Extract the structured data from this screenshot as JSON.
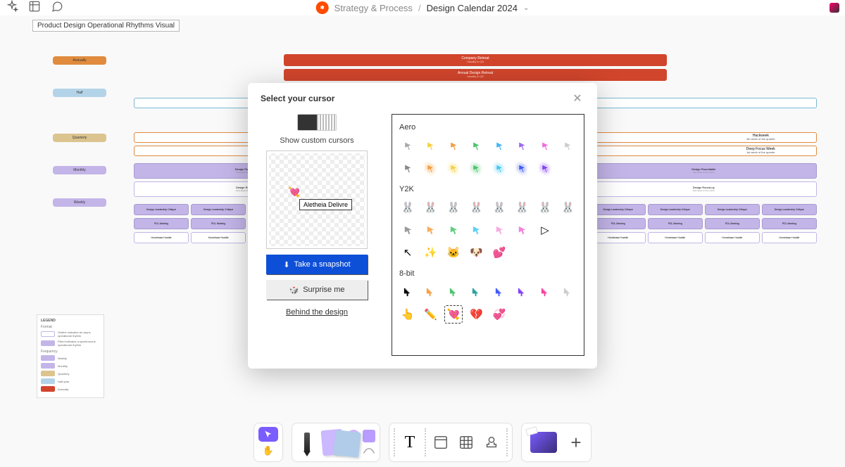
{
  "header": {
    "app": "zapier",
    "breadcrumb1": "Strategy & Process",
    "breadcrumb2": "Design Calendar 2024"
  },
  "doc_title": "Product Design Operational Rhythms Visual",
  "side_pills": [
    {
      "label": "Annually",
      "kind": "orange"
    },
    {
      "label": "Half",
      "kind": "blue"
    },
    {
      "label": "Quarterly",
      "kind": "tan",
      "gap": 60
    },
    {
      "label": "Monthly",
      "kind": "purple",
      "gap": 46
    },
    {
      "label": "Weekly",
      "kind": "purple",
      "gap": 46
    }
  ],
  "legend": {
    "title": "LEGEND",
    "format_label": "Format",
    "rows_format": [
      {
        "color": "#ffffff",
        "border": "#c3b5e8",
        "text": "Outline indicates an async operational rhythm"
      },
      {
        "color": "#c3b5e8",
        "text": "Filled indicates a synchronous operational rhythm"
      }
    ],
    "frequency_label": "Frequency",
    "rows_freq": [
      {
        "color": "#c3b5e8",
        "text": "Weekly"
      },
      {
        "color": "#c3b5e8",
        "text": "Monthly"
      },
      {
        "color": "#dcc48e",
        "text": "Quarterly"
      },
      {
        "color": "#b3d4e8",
        "text": "Half-year"
      },
      {
        "color": "#d1452c",
        "text": "Annually"
      }
    ]
  },
  "timeline": {
    "red_bars": [
      {
        "title": "Company Retreat",
        "sub": "Usually in Q3"
      },
      {
        "title": "Annual Design Retreat",
        "sub": "Usually in Q2"
      }
    ],
    "hackweek": {
      "title": "Hackweek",
      "sub": "4th week of the quarter"
    },
    "deep_focus": {
      "title": "Deep Focus Week",
      "sub": "1st week of the quarter"
    },
    "roundtables": [
      {
        "title": "Design Roundtable",
        "sub": "2nd week of the month"
      },
      {
        "title": "Design Roundtable",
        "sub": "2nd week of the month"
      },
      {
        "title": "Design Roundtable",
        "sub": "2nd week of the month"
      }
    ],
    "roundups": [
      {
        "title": "Design Round-up",
        "sub": "End week of the month"
      },
      {
        "title": "Design Round-up",
        "sub": "End week of the month"
      },
      {
        "title": "Design Round-up",
        "sub": "End week of the month"
      }
    ],
    "weekly_row1": {
      "title": "Design Leadership Critique",
      "sub": ""
    },
    "weekly_row2": {
      "title": "PDL Meeting"
    },
    "weekly_row3": {
      "title": "Homebase Huddle"
    }
  },
  "modal": {
    "title": "Select your cursor",
    "show_label": "Show custom cursors",
    "preview_name": "Aletheia Delivre",
    "snapshot_label": "Take a snapshot",
    "surprise_label": "Surprise me",
    "link_label": "Behind the design",
    "groups": [
      {
        "name": "Aero",
        "cursors": [
          {
            "c": "#aaa"
          },
          {
            "c": "#f5d142"
          },
          {
            "c": "#f59e42"
          },
          {
            "c": "#4cc46e"
          },
          {
            "c": "#42b6f5"
          },
          {
            "c": "#9b6bf2"
          },
          {
            "c": "#f26bdb"
          },
          {
            "c": "#ccc"
          },
          {
            "c": "#888"
          },
          {
            "c": "#f59e42",
            "glow": 1
          },
          {
            "c": "#f5d142",
            "glow": 1
          },
          {
            "c": "#4cc46e",
            "glow": 1
          },
          {
            "c": "#42c8f5",
            "glow": 1
          },
          {
            "c": "#425af5",
            "glow": 1
          },
          {
            "c": "#8542f5",
            "glow": 1
          }
        ]
      },
      {
        "name": "Y2K",
        "cursors": [
          {
            "emoji": "🐰"
          },
          {
            "emoji": "🐰"
          },
          {
            "emoji": "🐰"
          },
          {
            "emoji": "🐰"
          },
          {
            "emoji": "🐰"
          },
          {
            "emoji": "🐰"
          },
          {
            "emoji": "🐰"
          },
          {
            "emoji": "🐰"
          },
          {
            "c": "#888",
            "y2k": 1
          },
          {
            "c": "#f59e42",
            "y2k": 1
          },
          {
            "c": "#4cc46e",
            "y2k": 1
          },
          {
            "c": "#42c8f5",
            "y2k": 1
          },
          {
            "c": "#f59dde",
            "y2k": 1
          },
          {
            "c": "#f26bdb",
            "y2k": 1
          },
          {
            "emoji": "▷"
          },
          {
            "blank": 1
          },
          {
            "emoji": "↖",
            "bw": 1
          },
          {
            "emoji": "✨"
          },
          {
            "emoji": "🐱"
          },
          {
            "emoji": "🐶"
          },
          {
            "emoji": "💕"
          }
        ]
      },
      {
        "name": "8-bit",
        "cursors": [
          {
            "c": "#000",
            "px": 1
          },
          {
            "c": "#f59e42",
            "px": 1
          },
          {
            "c": "#4cc46e",
            "px": 1
          },
          {
            "c": "#25a0a0",
            "px": 1
          },
          {
            "c": "#425af5",
            "px": 1
          },
          {
            "c": "#8542f5",
            "px": 1
          },
          {
            "c": "#f542a1",
            "px": 1
          },
          {
            "c": "#ccc",
            "px": 1
          },
          {
            "emoji": "👆"
          },
          {
            "emoji": "✏️"
          },
          {
            "emoji": "💘",
            "sel": 1
          },
          {
            "emoji": "💔"
          },
          {
            "emoji": "💞"
          }
        ]
      }
    ]
  },
  "toolbar": {
    "tools": [
      "select",
      "hand",
      "pen",
      "sticky",
      "shapes",
      "text",
      "frame",
      "table",
      "stamp",
      "more",
      "add"
    ]
  }
}
